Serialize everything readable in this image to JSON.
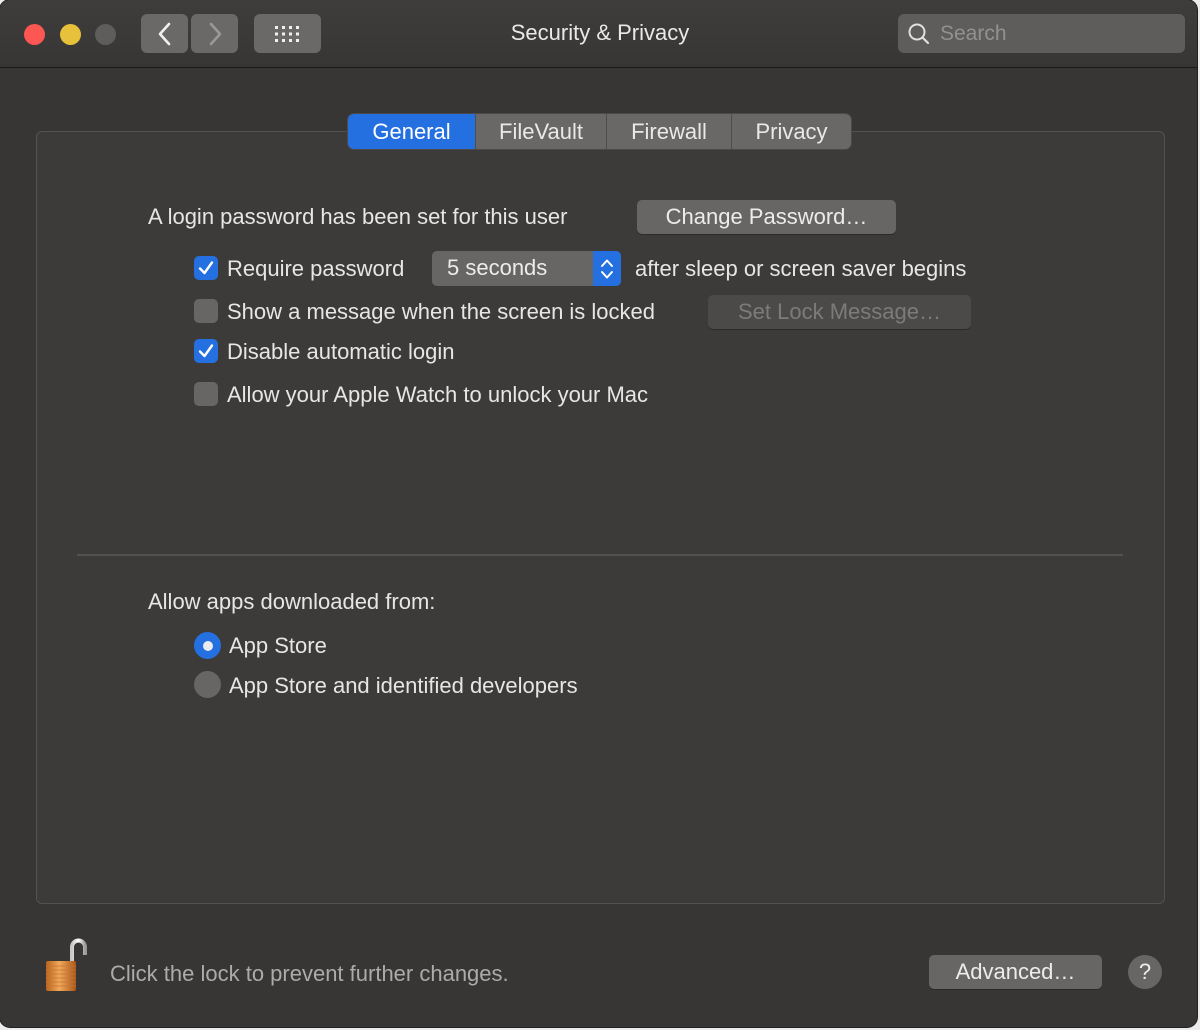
{
  "window": {
    "title": "Security & Privacy",
    "search_placeholder": "Search"
  },
  "toolbar": {
    "back_icon": "chevron-left-icon",
    "forward_icon": "chevron-right-icon",
    "grid_icon": "show-all-grid-icon"
  },
  "tabs": [
    {
      "label": "General",
      "active": true
    },
    {
      "label": "FileVault",
      "active": false
    },
    {
      "label": "Firewall",
      "active": false
    },
    {
      "label": "Privacy",
      "active": false
    }
  ],
  "general": {
    "login_password_text": "A login password has been set for this user",
    "change_password_button": "Change Password…",
    "require_password": {
      "label": "Require password",
      "checked": true,
      "selected_value": "5 seconds",
      "suffix": "after sleep or screen saver begins"
    },
    "show_message": {
      "label": "Show a message when the screen is locked",
      "checked": false,
      "button": "Set Lock Message…",
      "button_enabled": false
    },
    "disable_auto_login": {
      "label": "Disable automatic login",
      "checked": true
    },
    "apple_watch": {
      "label": "Allow your Apple Watch to unlock your Mac",
      "checked": false
    },
    "allow_apps_label": "Allow apps downloaded from:",
    "allow_apps_options": [
      {
        "label": "App Store",
        "selected": true
      },
      {
        "label": "App Store and identified developers",
        "selected": false
      }
    ]
  },
  "footer": {
    "lock_icon": "unlocked-padlock-icon",
    "lock_text": "Click the lock to prevent further changes.",
    "advanced_button": "Advanced…",
    "help_button": "?"
  },
  "colors": {
    "accent": "#2470e0",
    "close": "#fc5753",
    "minimize": "#e7c13a",
    "window_bg": "#383634"
  }
}
